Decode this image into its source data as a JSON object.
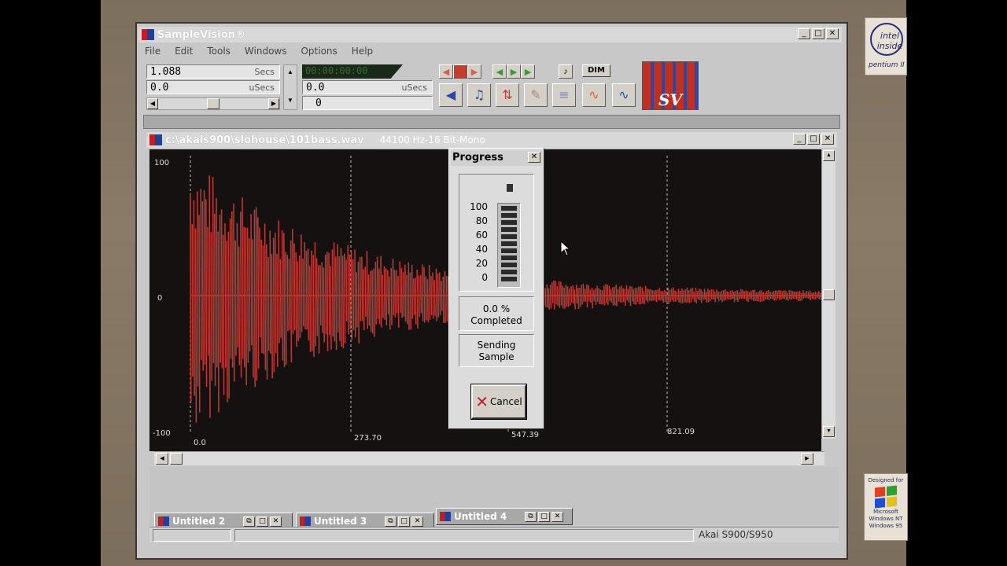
{
  "app": {
    "title": "SampleVision®",
    "menu": [
      "File",
      "Edit",
      "Tools",
      "Windows",
      "Options",
      "Help"
    ]
  },
  "toolbar": {
    "time_value": "1.088",
    "time_unit": "Secs",
    "offset_value": "0.0",
    "offset_unit": "uSecs",
    "timecode": "00:00:00:00",
    "pos_value": "0.0",
    "pos_unit": "uSecs",
    "count_value": "0",
    "dim_label": "DIM",
    "logo_text": "SV"
  },
  "wave_window": {
    "path": "c:\\akais900\\slohouse\\101bass.wav",
    "format": "44100 Hz-16 Bit-Mono",
    "y_labels": [
      "100",
      "0",
      "-100"
    ],
    "x_labels": [
      "0.0",
      "273.70",
      "547.39",
      "821.09"
    ],
    "wave_color": "#b83a34",
    "background": "#151111"
  },
  "progress": {
    "title": "Progress",
    "scale": [
      "100",
      "80",
      "60",
      "40",
      "20",
      "0"
    ],
    "percent": "0.0 %",
    "percent_value": 0.0,
    "completed": "Completed",
    "status_line1": "Sending",
    "status_line2": "Sample",
    "cancel_label": "Cancel"
  },
  "minimized": [
    {
      "title": "Untitled 2"
    },
    {
      "title": "Untitled 3"
    },
    {
      "title": "Untitled 4"
    }
  ],
  "statusbar": {
    "device": "Akai S900/S950"
  },
  "stickers": {
    "intel_top": "intel inside",
    "intel_bottom": "pentium II",
    "windows_top": "Designed for",
    "windows_bottom": "Microsoft Windows NT Windows 95"
  }
}
